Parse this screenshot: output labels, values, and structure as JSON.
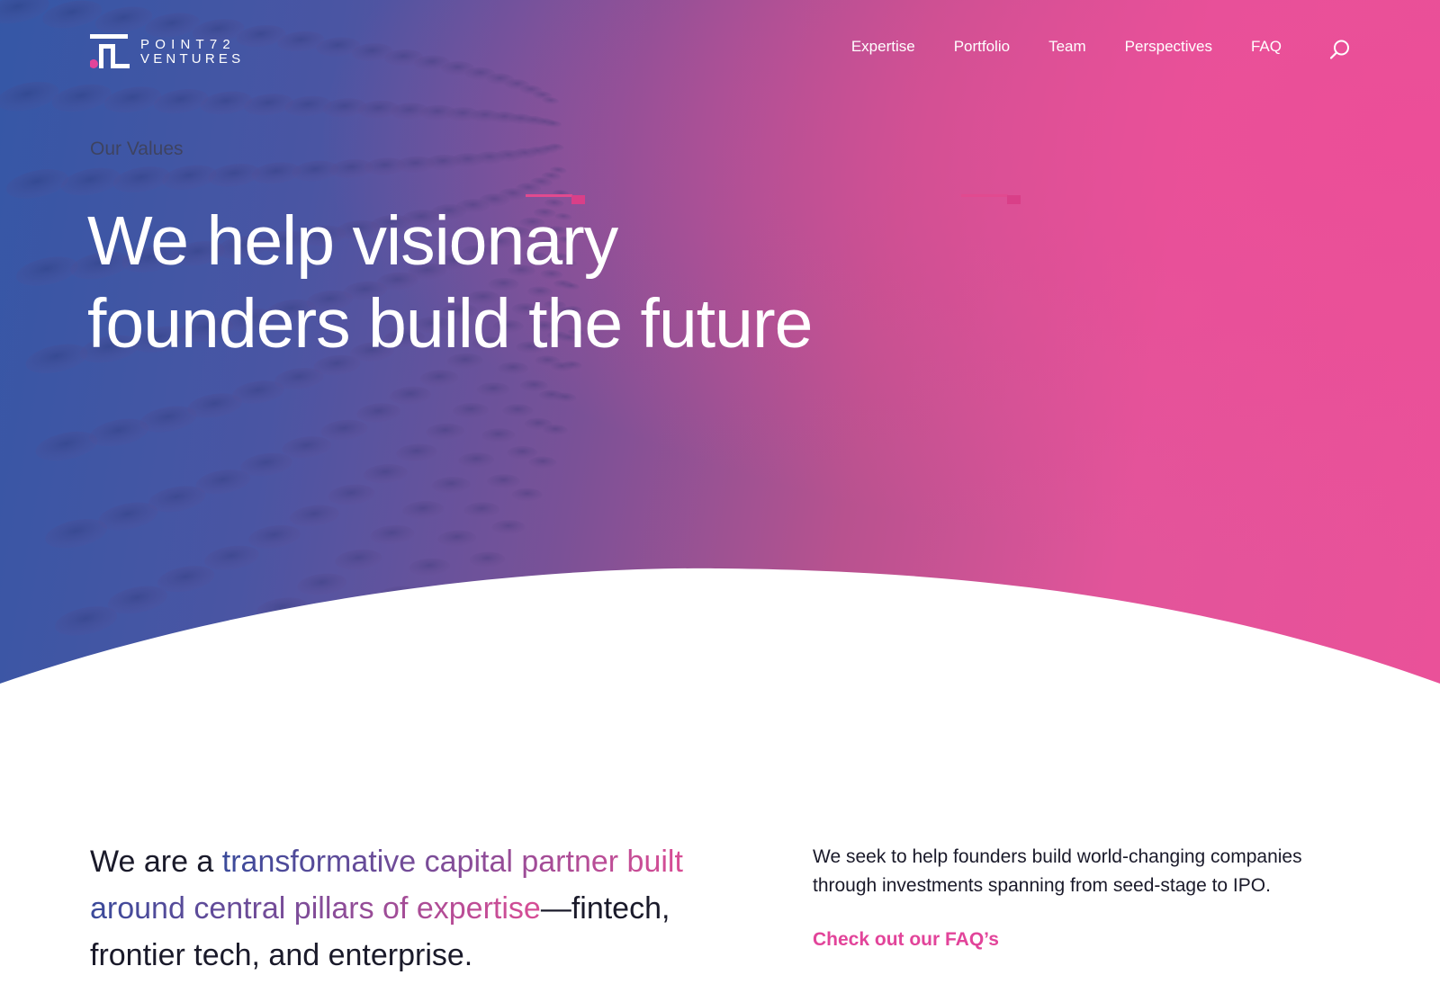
{
  "brand": {
    "name_line1": "POINT72",
    "name_line2": "VENTURES",
    "accent": "#e2449a"
  },
  "nav": {
    "items": [
      {
        "label": "Expertise"
      },
      {
        "label": "Portfolio"
      },
      {
        "label": "Team"
      },
      {
        "label": "Perspectives"
      },
      {
        "label": "FAQ"
      }
    ],
    "search_icon": "search-icon"
  },
  "hero": {
    "eyebrow": "Our Values",
    "headline_line1": "We help visionary",
    "headline_line2": "founders build the future",
    "colors": {
      "start": "#3557a6",
      "end": "#ea5199"
    }
  },
  "intro": {
    "prefix": "We are a ",
    "highlight_1": "transformative capital partner built",
    "highlight_2": "around central pillars of expertise",
    "suffix": "—fintech, frontier tech, and enterprise."
  },
  "side": {
    "text": "We seek to help founders build world-changing companies through investments spanning from seed-stage to IPO.",
    "link_label": "Check out our FAQ’s"
  }
}
